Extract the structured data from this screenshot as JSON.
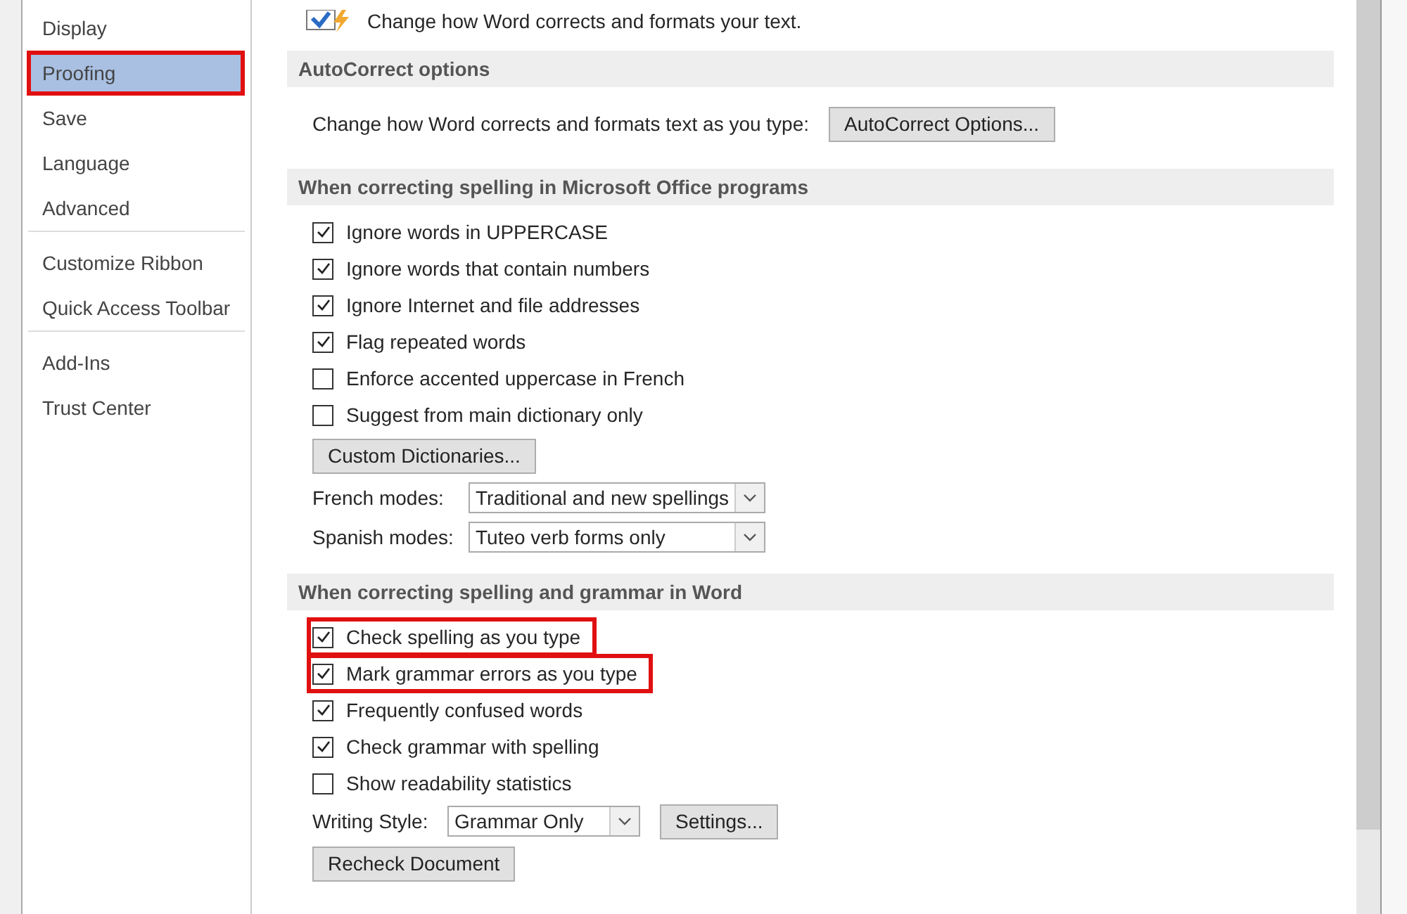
{
  "sidebar": {
    "groups": [
      [
        {
          "label": "Display",
          "selected": false,
          "highlighted": false
        },
        {
          "label": "Proofing",
          "selected": true,
          "highlighted": true
        },
        {
          "label": "Save",
          "selected": false,
          "highlighted": false
        },
        {
          "label": "Language",
          "selected": false,
          "highlighted": false
        },
        {
          "label": "Advanced",
          "selected": false,
          "highlighted": false
        }
      ],
      [
        {
          "label": "Customize Ribbon",
          "selected": false,
          "highlighted": false
        },
        {
          "label": "Quick Access Toolbar",
          "selected": false,
          "highlighted": false
        }
      ],
      [
        {
          "label": "Add-Ins",
          "selected": false,
          "highlighted": false
        },
        {
          "label": "Trust Center",
          "selected": false,
          "highlighted": false
        }
      ]
    ]
  },
  "intro": "Change how Word corrects and formats your text.",
  "sections": [
    {
      "title": "AutoCorrect options",
      "items": [
        {
          "kind": "text_button",
          "label": "Change how Word corrects and formats text as you type:",
          "button": "AutoCorrect Options..."
        }
      ]
    },
    {
      "title": "When correcting spelling in Microsoft Office programs",
      "items": [
        {
          "kind": "checkbox",
          "label": "Ignore words in UPPERCASE",
          "checked": true,
          "highlighted": false
        },
        {
          "kind": "checkbox",
          "label": "Ignore words that contain numbers",
          "checked": true,
          "highlighted": false
        },
        {
          "kind": "checkbox",
          "label": "Ignore Internet and file addresses",
          "checked": true,
          "highlighted": false
        },
        {
          "kind": "checkbox",
          "label": "Flag repeated words",
          "checked": true,
          "highlighted": false
        },
        {
          "kind": "checkbox",
          "label": "Enforce accented uppercase in French",
          "checked": false,
          "highlighted": false
        },
        {
          "kind": "checkbox",
          "label": "Suggest from main dictionary only",
          "checked": false,
          "highlighted": false
        },
        {
          "kind": "button",
          "label": "Custom Dictionaries..."
        },
        {
          "kind": "dropdown",
          "label": "French modes:",
          "value": "Traditional and new spellings"
        },
        {
          "kind": "dropdown",
          "label": "Spanish modes:",
          "value": "Tuteo verb forms only"
        }
      ]
    },
    {
      "title": "When correcting spelling and grammar in Word",
      "items": [
        {
          "kind": "checkbox",
          "label": "Check spelling as you type",
          "checked": true,
          "highlighted": true
        },
        {
          "kind": "checkbox",
          "label": "Mark grammar errors as you type",
          "checked": true,
          "highlighted": true
        },
        {
          "kind": "checkbox",
          "label": "Frequently confused words",
          "checked": true,
          "highlighted": false
        },
        {
          "kind": "checkbox",
          "label": "Check grammar with spelling",
          "checked": true,
          "highlighted": false
        },
        {
          "kind": "checkbox",
          "label": "Show readability statistics",
          "checked": false,
          "highlighted": false
        },
        {
          "kind": "dropdown_button",
          "label": "Writing Style:",
          "value": "Grammar Only",
          "button": "Settings..."
        },
        {
          "kind": "button",
          "label": "Recheck Document"
        }
      ]
    }
  ]
}
